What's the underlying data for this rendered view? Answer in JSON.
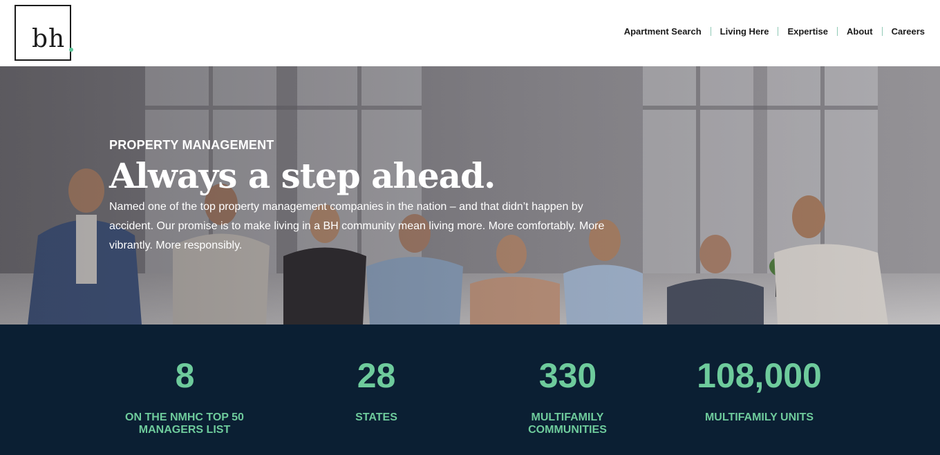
{
  "logo": {
    "text": "bh",
    "accent": "#5ec79b"
  },
  "nav": {
    "items": [
      {
        "label": "Apartment Search"
      },
      {
        "label": "Living Here"
      },
      {
        "label": "Expertise"
      },
      {
        "label": "About"
      },
      {
        "label": "Careers"
      }
    ]
  },
  "hero": {
    "eyebrow": "PROPERTY MANAGEMENT",
    "title": "Always a step ahead.",
    "body": "Named one of the top property management companies in the nation – and that didn’t happen by accident. Our promise is to make living in a BH community mean living more. More comfortably. More vibrantly. More responsibly."
  },
  "stats": [
    {
      "value": "8",
      "label": "ON THE NMHC TOP 50 MANAGERS LIST"
    },
    {
      "value": "28",
      "label": "STATES"
    },
    {
      "value": "330",
      "label": "MULTIFAMILY COMMUNITIES"
    },
    {
      "value": "108,000",
      "label": "MULTIFAMILY UNITS"
    }
  ],
  "colors": {
    "stats_bg": "#0b1f33",
    "stats_accent": "#6ecb9c"
  }
}
